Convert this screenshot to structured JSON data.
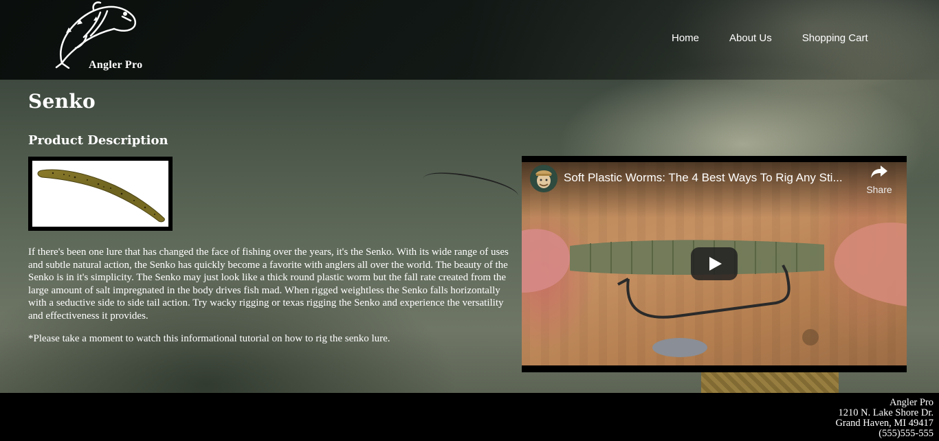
{
  "brand": {
    "name": "Angler Pro"
  },
  "nav": {
    "items": [
      {
        "label": "Home"
      },
      {
        "label": "About Us"
      },
      {
        "label": "Shopping Cart"
      }
    ]
  },
  "product": {
    "title": "Senko",
    "section_title": "Product Description",
    "description": "If there's been one lure that has changed the face of fishing over the years, it's the Senko. With its wide range of uses and subtle natural action, the Senko has quickly become a favorite with anglers all over the world. The beauty of the Senko is in it's simplicity. The Senko may just look like a thick round plastic worm but the fall rate created from the large amount of salt impregnated in the body drives fish mad. When rigged weightless the Senko falls horizontally with a seductive side to side tail action. Try wacky rigging or texas rigging the Senko and experience the versatility and effectiveness it provides.",
    "note": "*Please take a moment to watch this informational tutorial on how to rig the senko lure."
  },
  "video": {
    "title": "Soft Plastic Worms: The 4 Best Ways To Rig Any Sti...",
    "share_label": "Share"
  },
  "footer": {
    "lines": [
      "Angler Pro",
      "1210 N. Lake Shore Dr.",
      "Grand Haven, MI 49417",
      "(555)555-555"
    ]
  }
}
